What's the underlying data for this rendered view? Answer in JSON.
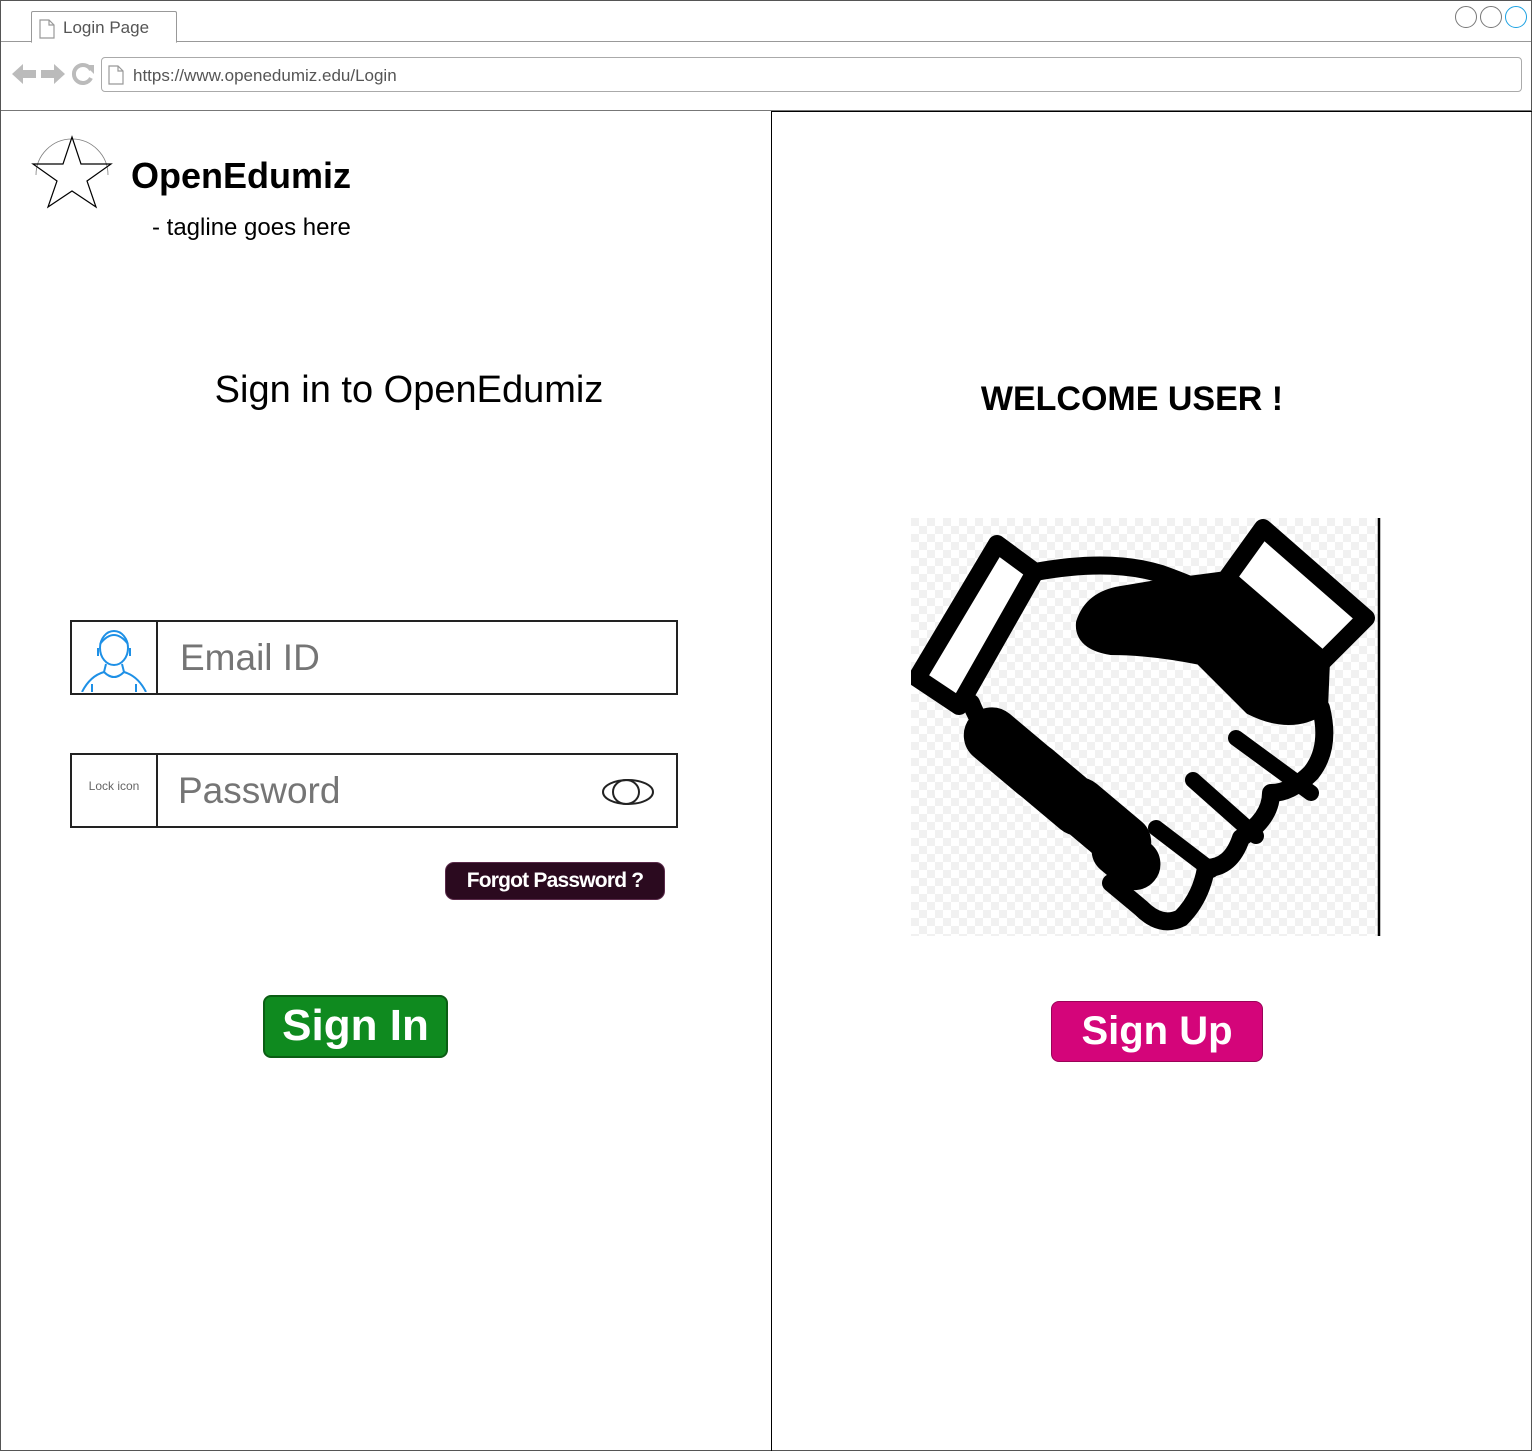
{
  "browser": {
    "tab_title": "Login Page",
    "url": "https://www.openedumiz.edu/Login"
  },
  "brand": {
    "name": "OpenEdumiz",
    "tagline": "- tagline goes here"
  },
  "signin": {
    "title": "Sign in to OpenEdumiz",
    "email_placeholder": "Email ID",
    "password_placeholder": "Password",
    "lock_icon_text": "Lock icon",
    "forgot_label": "Forgot Password ?",
    "signin_label": "Sign In"
  },
  "signup": {
    "welcome": "WELCOME USER !",
    "signup_label": "Sign Up"
  },
  "icons": {
    "logo": "star-icon",
    "email": "user-avatar-icon",
    "password": "lock-icon",
    "show_password": "eye-icon",
    "illustration": "handshake-icon"
  },
  "colors": {
    "signin_button": "#0f8a1f",
    "signup_button": "#d4057a",
    "forgot_button": "#2b0a1f",
    "user_icon": "#1e90e6"
  }
}
